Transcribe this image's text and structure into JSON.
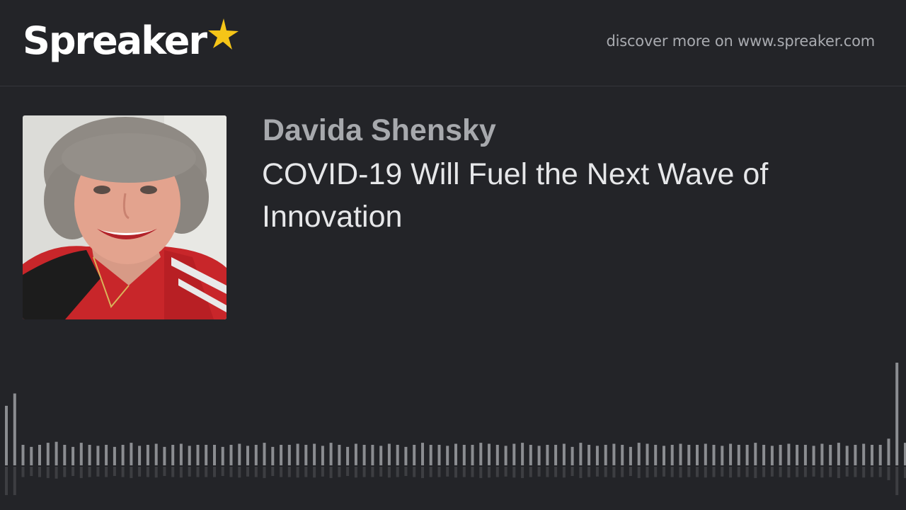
{
  "header": {
    "logo_text": "Spreaker",
    "logo_icon": "star-icon",
    "discover_text": "discover more on www.spreaker.com"
  },
  "episode": {
    "author": "Davida Shensky",
    "title": "COVID-19 Will Fuel the Next Wave of Innovation"
  },
  "colors": {
    "background": "#232428",
    "star": "#f5c518",
    "waveform": "#8b8d91"
  },
  "waveform": {
    "levels": [
      0.58,
      0.7,
      0.2,
      0.18,
      0.2,
      0.22,
      0.23,
      0.2,
      0.18,
      0.22,
      0.2,
      0.19,
      0.2,
      0.18,
      0.2,
      0.22,
      0.19,
      0.2,
      0.21,
      0.18,
      0.2,
      0.21,
      0.19,
      0.2,
      0.2,
      0.2,
      0.18,
      0.2,
      0.21,
      0.19,
      0.2,
      0.22,
      0.18,
      0.2,
      0.2,
      0.21,
      0.2,
      0.21,
      0.19,
      0.22,
      0.2,
      0.18,
      0.21,
      0.2,
      0.2,
      0.19,
      0.21,
      0.2,
      0.18,
      0.2,
      0.22,
      0.2,
      0.2,
      0.19,
      0.21,
      0.2,
      0.2,
      0.22,
      0.21,
      0.2,
      0.19,
      0.21,
      0.22,
      0.2,
      0.19,
      0.2,
      0.2,
      0.21,
      0.18,
      0.22,
      0.2,
      0.19,
      0.2,
      0.21,
      0.2,
      0.18,
      0.22,
      0.21,
      0.2,
      0.19,
      0.2,
      0.21,
      0.2,
      0.2,
      0.21,
      0.2,
      0.19,
      0.21,
      0.2,
      0.2,
      0.22,
      0.2,
      0.19,
      0.2,
      0.21,
      0.2,
      0.2,
      0.19,
      0.21,
      0.2,
      0.22,
      0.19,
      0.2,
      0.21,
      0.2,
      0.2,
      0.26,
      1.0,
      0.22
    ]
  }
}
